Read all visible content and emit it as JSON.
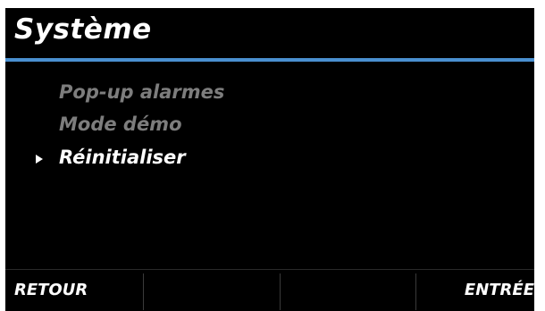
{
  "header": {
    "title": "Système"
  },
  "colors": {
    "background": "#000000",
    "accent_line": "#4a90d0",
    "item_dim": "#7d7d7d",
    "item_selected": "#ffffff"
  },
  "menu": {
    "items": [
      {
        "label": "Pop-up alarmes",
        "selected": false
      },
      {
        "label": "Mode démo",
        "selected": false
      },
      {
        "label": "Réinitialiser",
        "selected": true
      }
    ],
    "cursor_icon": "triangle-right-icon"
  },
  "softkeys": {
    "left_label": "RETOUR",
    "center_left_label": "",
    "center_right_label": "",
    "right_label": "ENTRÉE"
  }
}
